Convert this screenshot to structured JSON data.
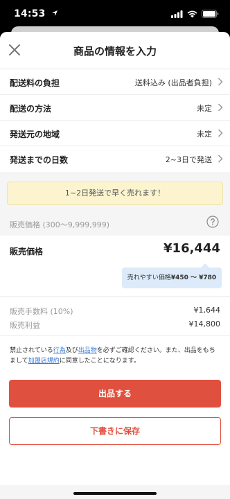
{
  "status_bar": {
    "time": "14:53"
  },
  "nav": {
    "title": "商品の情報を入力"
  },
  "shipping_rows": [
    {
      "label": "配送料の負担",
      "value": "送料込み (出品者負担)"
    },
    {
      "label": "配送の方法",
      "value": "未定"
    },
    {
      "label": "発送元の地域",
      "value": "未定"
    },
    {
      "label": "発送までの日数",
      "value": "2~3日で発送"
    }
  ],
  "hint": {
    "text": "1~2日発送で早く売れます！"
  },
  "price_range": {
    "label": "販売価格 (300～9,999,999)"
  },
  "price": {
    "label": "販売価格",
    "value": "¥16,444",
    "tooltip_prefix": "売れやすい価格",
    "tooltip_range": "¥450 ～ ¥780"
  },
  "fees": {
    "fee_label": "販売手数料 (10%)",
    "fee_value": "¥1,644",
    "profit_label": "販売利益",
    "profit_value": "¥14,800"
  },
  "terms": {
    "t1": "禁止されている",
    "link_actions": "行為",
    "t2": "及び",
    "link_items": "出品物",
    "t3": "を必ずご確認ください。また、出品をもちまして",
    "link_agreement": "加盟店規約",
    "t4": "に同意したことになります。"
  },
  "buttons": {
    "list_label": "出品する",
    "draft_label": "下書きに保存"
  },
  "colors": {
    "accent": "#e0503e",
    "hint_bg": "#fbf4cf",
    "tooltip_bg": "#dceafa",
    "link": "#3a7bd5"
  },
  "icons": [
    "location-arrow-icon",
    "signal-icon",
    "wifi-icon",
    "battery-icon",
    "close-icon",
    "chevron-right-icon",
    "help-icon"
  ]
}
